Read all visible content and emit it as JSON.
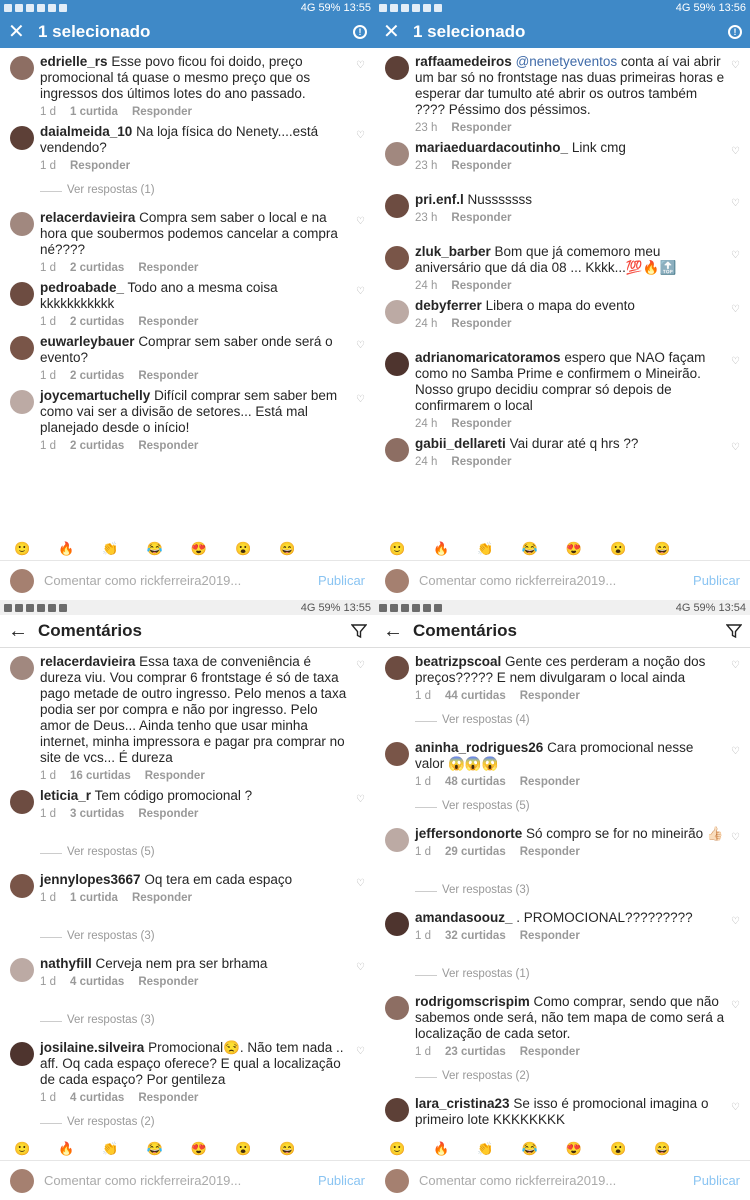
{
  "status": {
    "tl": "13:55",
    "tr": "13:56",
    "bl": "13:55",
    "br": "13:54",
    "battery": "59%",
    "net": "4G"
  },
  "selection_title": "1 selecionado",
  "comments_title": "Comentários",
  "input_placeholder": "Comentar como rickferreira2019...",
  "publish": "Publicar",
  "reply": "Responder",
  "emojis": [
    "🙂",
    "🔥",
    "👏",
    "😂",
    "😍",
    "😮",
    "😄"
  ],
  "panels": [
    {
      "comments": [
        {
          "user": "edrielle_rs",
          "text": "Esse povo ficou foi doido, preço promocional tá quase o mesmo preço que os ingressos dos últimos lotes do ano passado.",
          "time": "1 d",
          "likes": "1 curtida"
        },
        {
          "user": "daialmeida_10",
          "text": "Na loja física do Nenety....está vendendo?",
          "time": "1 d",
          "likes": "",
          "replies": "Ver respostas (1)"
        },
        {
          "user": "relacerdavieira",
          "text": "Compra sem saber o local e na hora que soubermos podemos cancelar a compra né????",
          "time": "1 d",
          "likes": "2 curtidas"
        },
        {
          "user": "pedroabade_",
          "text": "Todo ano a mesma coisa kkkkkkkkkkk",
          "time": "1 d",
          "likes": "2 curtidas"
        },
        {
          "user": "euwarleybauer",
          "text": "Comprar sem saber onde será o evento?",
          "time": "1 d",
          "likes": "2 curtidas"
        },
        {
          "user": "joycemartuchelly",
          "text": "Difícil comprar sem saber bem como vai ser a divisão de setores... Está mal planejado desde o início!",
          "time": "1 d",
          "likes": "2 curtidas"
        }
      ]
    },
    {
      "comments": [
        {
          "user": "raffaamedeiros",
          "mention": "@nenetyeventos",
          "text": " conta aí vai abrir um bar só no frontstage nas duas primeiras horas e esperar dar tumulto até abrir os outros também ???? Péssimo dos péssimos.",
          "time": "23 h",
          "likes": ""
        },
        {
          "user": "mariaeduardacoutinho_",
          "text": "Link cmg",
          "time": "23 h",
          "likes": ""
        },
        {
          "user": "pri.enf.l",
          "text": "Nusssssss",
          "time": "23 h",
          "likes": ""
        },
        {
          "user": "zluk_barber",
          "text": "Bom que já comemoro meu aniversário que dá dia 08 ... Kkkk...💯🔥🔝",
          "time": "24 h",
          "likes": ""
        },
        {
          "user": "debyferrer",
          "text": "Libera o mapa do evento",
          "time": "24 h",
          "likes": ""
        },
        {
          "user": "adrianomaricatoramos",
          "text": "espero que NAO façam como no Samba Prime e confirmem o Mineirão. Nosso grupo decidiu comprar só depois de confirmarem o local",
          "time": "24 h",
          "likes": ""
        },
        {
          "user": "gabii_dellareti",
          "text": "Vai durar até q hrs ??",
          "time": "24 h",
          "likes": ""
        }
      ]
    },
    {
      "comments": [
        {
          "user": "relacerdavieira",
          "text": "Essa taxa de conveniência é dureza viu. Vou comprar 6 frontstage é só de taxa pago metade de outro ingresso. Pelo menos a taxa podia ser por compra e não por ingresso. Pelo amor de Deus... Ainda tenho que usar minha internet, minha impressora e pagar pra comprar no site de vcs... É dureza",
          "time": "1 d",
          "likes": "16 curtidas"
        },
        {
          "user": "leticia_r",
          "text": "Tem código promocional ?",
          "time": "1 d",
          "likes": "3 curtidas",
          "replies": "Ver respostas (5)"
        },
        {
          "user": "jennylopes3667",
          "text": "Oq tera em cada espaço",
          "time": "1 d",
          "likes": "1 curtida",
          "replies": "Ver respostas (3)"
        },
        {
          "user": "nathyfill",
          "text": "Cerveja nem pra ser brhama",
          "time": "1 d",
          "likes": "4 curtidas",
          "replies": "Ver respostas (3)"
        },
        {
          "user": "josilaine.silveira",
          "text": "Promocional😒. Não tem nada .. aff. Oq cada espaço oferece? E qual a localização de cada espaço? Por gentileza",
          "time": "1 d",
          "likes": "4 curtidas",
          "replies": "Ver respostas (2)"
        }
      ]
    },
    {
      "comments": [
        {
          "user": "beatrizpscoal",
          "text": "Gente ces perderam a noção dos preços????? E nem divulgaram o local ainda",
          "time": "1 d",
          "likes": "44 curtidas",
          "replies": "Ver respostas (4)"
        },
        {
          "user": "aninha_rodrigues26",
          "text": "Cara promocional nesse valor 😱😱😱",
          "time": "1 d",
          "likes": "48 curtidas",
          "replies": "Ver respostas (5)"
        },
        {
          "user": "jeffersondonorte",
          "text": "Só compro se for no mineirão 👍🏻",
          "time": "1 d",
          "likes": "29 curtidas",
          "replies": "Ver respostas (3)"
        },
        {
          "user": "amandasoouz_",
          "text": ". PROMOCIONAL?????????",
          "time": "1 d",
          "likes": "32 curtidas",
          "replies": "Ver respostas (1)"
        },
        {
          "user": "rodrigomscrispim",
          "text": "Como comprar, sendo que não sabemos onde será, não tem mapa de como será a localização de cada setor.",
          "time": "1 d",
          "likes": "23 curtidas",
          "replies": "Ver respostas (2)"
        },
        {
          "user": "lara_cristina23",
          "text": "Se isso é promocional imagina o primeiro lote KKKKKKKK",
          "time": "",
          "likes": ""
        }
      ]
    }
  ]
}
